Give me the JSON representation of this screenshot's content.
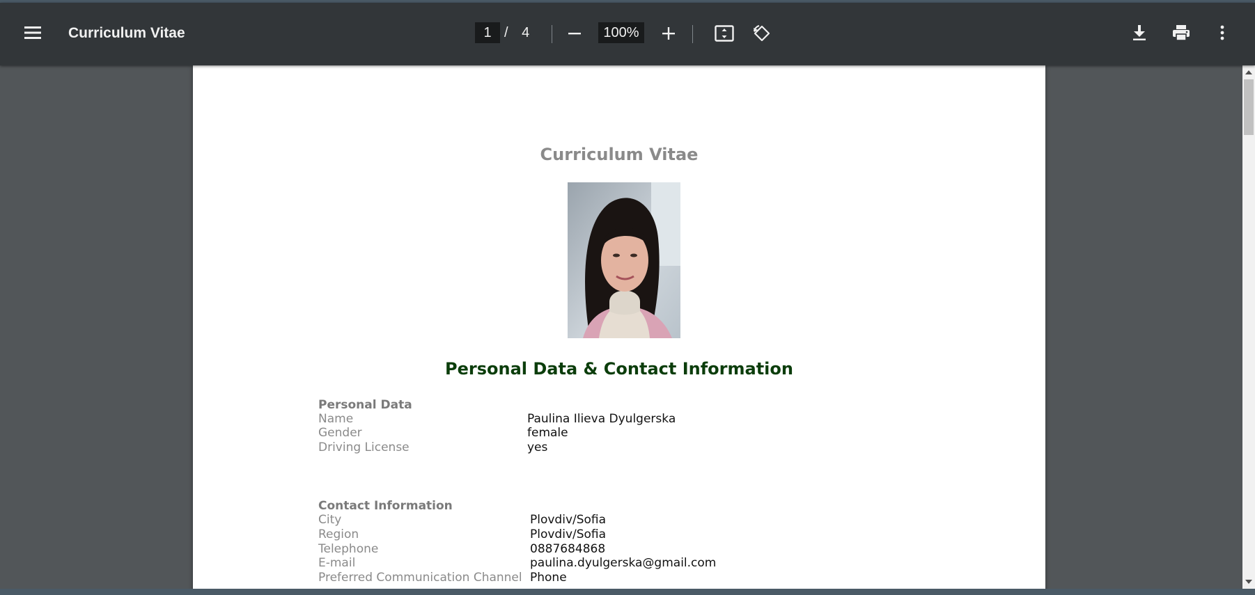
{
  "toolbar": {
    "title": "Curriculum Vitae",
    "current_page": "1",
    "page_separator": "/",
    "total_pages": "4",
    "zoom": "100%",
    "icons": [
      "menu-icon",
      "zoom-out-icon",
      "zoom-in-icon",
      "fit-page-icon",
      "rotate-icon",
      "download-icon",
      "print-icon",
      "more-options-icon"
    ]
  },
  "document": {
    "heading": "Curriculum Vitae",
    "section_title": "Personal Data & Contact Information",
    "personal": {
      "title": "Personal Data",
      "rows": [
        {
          "label": "Name",
          "value": "Paulina Ilieva Dyulgerska"
        },
        {
          "label": "Gender",
          "value": "female"
        },
        {
          "label": "Driving License",
          "value": "yes"
        }
      ]
    },
    "contact": {
      "title": "Contact Information",
      "rows": [
        {
          "label": "City",
          "value": "Plovdiv/Sofia"
        },
        {
          "label": "Region",
          "value": "Plovdiv/Sofia"
        },
        {
          "label": "Telephone",
          "value": "0887684868"
        },
        {
          "label": "E-mail",
          "value": "paulina.dyulgerska@gmail.com"
        },
        {
          "label": "Preferred Communication Channel",
          "value": "Phone"
        }
      ]
    }
  },
  "colors": {
    "toolbar_bg": "#323639",
    "viewer_bg": "#525659",
    "section_title": "#0b3d0b",
    "heading_gray": "#8a8a8a"
  }
}
